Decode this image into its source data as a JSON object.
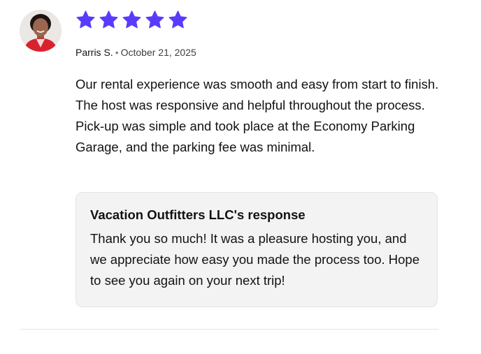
{
  "review": {
    "rating": 5,
    "max_rating": 5,
    "star_color": "#593CFB",
    "reviewer_name": "Parris S.",
    "separator": "•",
    "date": "October 21, 2025",
    "text": "Our rental experience was smooth and easy from start to finish. The host was responsive and helpful throughout the process. Pick-up was simple and took place at the Economy Parking Garage, and the parking fee was minimal.",
    "avatar_icon": "reviewer-photo"
  },
  "host_response": {
    "title": "Vacation Outfitters LLC's response",
    "text": "Thank you so much! It was a pleasure hosting you, and we appreciate how easy you made the process too. Hope to see you again on your next trip!"
  }
}
